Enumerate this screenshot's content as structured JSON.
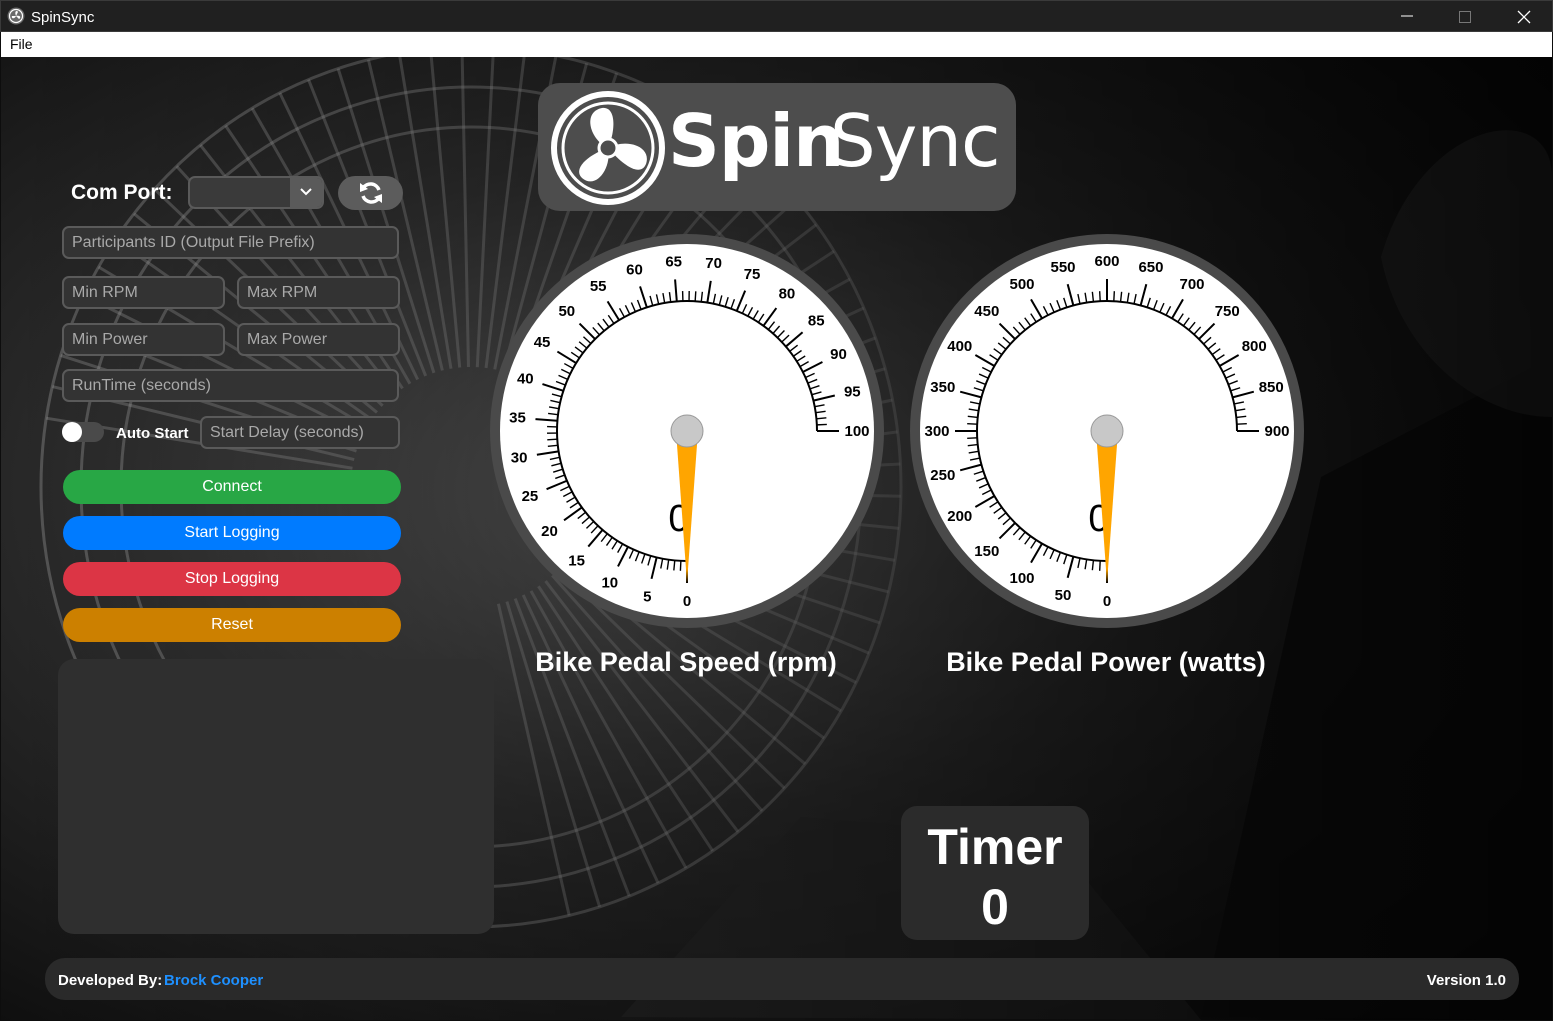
{
  "window": {
    "title": "SpinSync",
    "controls": [
      "minimize",
      "maximize",
      "close"
    ]
  },
  "menu": {
    "items": [
      {
        "label": "File"
      }
    ]
  },
  "logo": {
    "text_bold": "Spin",
    "text_light": "Sync",
    "icon": "fan-icon"
  },
  "controls": {
    "com_port_label": "Com Port:",
    "com_port_value": "",
    "refresh_icon": "refresh-icon",
    "participants_placeholder": "Participants ID (Output File Prefix)",
    "min_rpm_placeholder": "Min RPM",
    "max_rpm_placeholder": "Max RPM",
    "min_power_placeholder": "Min Power",
    "max_power_placeholder": "Max Power",
    "runtime_placeholder": "RunTime (seconds)",
    "auto_start_label": "Auto Start",
    "auto_start_on": false,
    "start_delay_placeholder": "Start Delay (seconds)"
  },
  "buttons": {
    "connect": "Connect",
    "start_logging": "Start Logging",
    "stop_logging": "Stop Logging",
    "reset": "Reset"
  },
  "colors": {
    "connect": "#28a745",
    "start_logging": "#007bff",
    "stop_logging": "#dc3545",
    "reset": "#cc8000",
    "needle": "#ffa500",
    "developer_name": "#1e90ff"
  },
  "gauges": {
    "speed": {
      "caption": "Bike Pedal Speed (rpm)",
      "min": 0,
      "max": 100,
      "step": 5,
      "labels": [
        "0",
        "5",
        "10",
        "15",
        "20",
        "25",
        "30",
        "35",
        "40",
        "45",
        "50",
        "55",
        "60",
        "65",
        "70",
        "75",
        "80",
        "85",
        "90",
        "95",
        "100"
      ],
      "value": 0,
      "value_text": "0"
    },
    "power": {
      "caption": "Bike Pedal Power (watts)",
      "min": 0,
      "max": 900,
      "step": 50,
      "labels": [
        "0",
        "50",
        "100",
        "150",
        "200",
        "250",
        "300",
        "350",
        "400",
        "450",
        "500",
        "550",
        "600",
        "650",
        "700",
        "750",
        "800",
        "850",
        "900"
      ],
      "value": 0,
      "value_text": "0"
    }
  },
  "timer": {
    "title": "Timer",
    "value": "0"
  },
  "footer": {
    "developed_by": "Developed By:",
    "developer": "Brock Cooper",
    "version": "Version 1.0"
  }
}
